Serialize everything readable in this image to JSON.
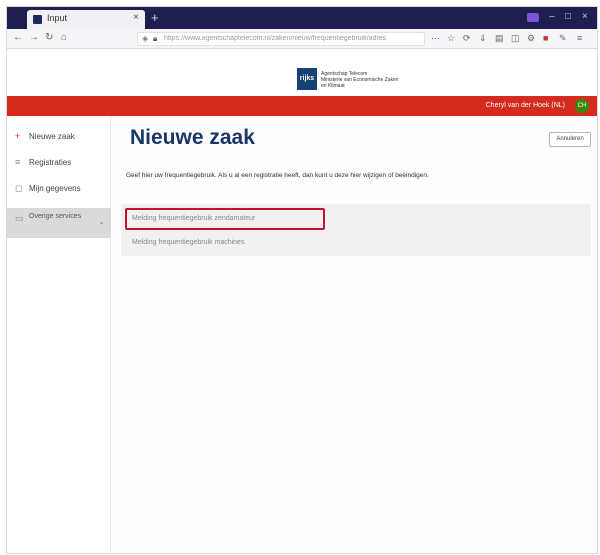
{
  "browser": {
    "tab_title": "Input",
    "tab_close": "×",
    "new_tab": "+",
    "url": "https://www.agentschaptelecom.nl/zaken/nieuw/frequentiegebruik/adres",
    "window_controls": [
      "–",
      "□",
      "×"
    ],
    "nav": {
      "back": "←",
      "forward": "→",
      "reload": "↻",
      "home": "⌂"
    },
    "toolbar_icons": [
      "⋯",
      "☆",
      "⟳",
      "⇓",
      "▤",
      "◫",
      "⚙",
      "■",
      "✎",
      "≡"
    ]
  },
  "site": {
    "logo_mark": "rijks",
    "logo_lines": [
      "Agentschap Telecom",
      "Ministerie van Economische Zaken",
      "en Klimaat"
    ],
    "user_name": "Cheryl van der Hoek (NL)",
    "user_initials": "CH"
  },
  "sidebar": {
    "items": [
      {
        "label": "Nieuwe zaak",
        "icon": "plus-icon"
      },
      {
        "label": "Registraties",
        "icon": "list-icon"
      },
      {
        "label": "Mijn gegevens",
        "icon": "user-icon"
      },
      {
        "label": "Overige services",
        "icon": "folder-icon"
      }
    ]
  },
  "main": {
    "title": "Nieuwe zaak",
    "cancel_label": "Annuleren",
    "instruction": "Geef hier uw frequentiegebruik. Als u al een registratie heeft, dan kunt u deze hier wijzigen of beëindigen.",
    "options": [
      "Melding frequentiegebruik zendamateur",
      "Melding frequentiegebruik machines"
    ]
  },
  "colors": {
    "brand_red": "#d52b1e",
    "title_blue": "#1a3668",
    "highlight": "#c8102e"
  }
}
